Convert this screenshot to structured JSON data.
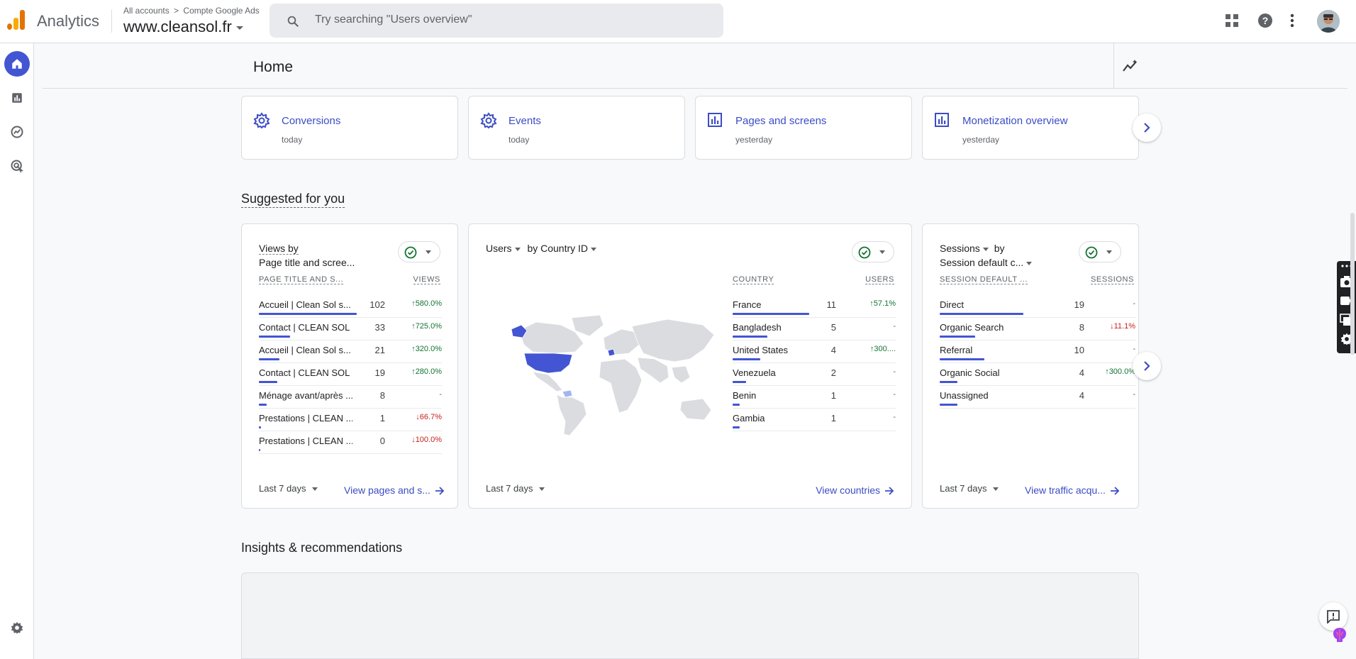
{
  "app": {
    "name": "Analytics",
    "breadcrumb_accounts": "All accounts",
    "breadcrumb_account": "Compte Google Ads",
    "property": "www.cleansol.fr"
  },
  "search": {
    "placeholder": "Try searching \"Users overview\""
  },
  "page": {
    "title": "Home"
  },
  "quick_cards": [
    {
      "title": "Conversions",
      "subtitle": "today",
      "icon": "gear-icon"
    },
    {
      "title": "Events",
      "subtitle": "today",
      "icon": "gear-icon"
    },
    {
      "title": "Pages and screens",
      "subtitle": "yesterday",
      "icon": "bar-chart-icon"
    },
    {
      "title": "Monetization overview",
      "subtitle": "yesterday",
      "icon": "bar-chart-icon"
    }
  ],
  "suggested": {
    "title": "Suggested for you",
    "pages_card": {
      "title_line1": "Views by",
      "title_line2": "Page title and scree...",
      "col_label": "PAGE TITLE AND S...",
      "col_value": "VIEWS",
      "rows": [
        {
          "label": "Accueil | Clean Sol s...",
          "value": "102",
          "change": "580.0%",
          "dir": "up",
          "bar": 1.0
        },
        {
          "label": "Contact | CLEAN SOL",
          "value": "33",
          "change": "725.0%",
          "dir": "up",
          "bar": 0.32
        },
        {
          "label": "Accueil | Clean Sol s...",
          "value": "21",
          "change": "320.0%",
          "dir": "up",
          "bar": 0.21
        },
        {
          "label": "Contact | CLEAN SOL",
          "value": "19",
          "change": "280.0%",
          "dir": "up",
          "bar": 0.19
        },
        {
          "label": "Ménage avant/après ...",
          "value": "8",
          "change": "-",
          "dir": "flat",
          "bar": 0.08
        },
        {
          "label": "Prestations | CLEAN ...",
          "value": "1",
          "change": "66.7%",
          "dir": "down",
          "bar": 0.01
        },
        {
          "label": "Prestations | CLEAN ...",
          "value": "0",
          "change": "100.0%",
          "dir": "down",
          "bar": 0.0
        }
      ],
      "range": "Last 7 days",
      "link": "View pages and s..."
    },
    "country_card": {
      "metric": "Users",
      "dimension": "by Country ID",
      "col_label": "COUNTRY",
      "col_value": "USERS",
      "rows": [
        {
          "label": "France",
          "value": "11",
          "change": "57.1%",
          "dir": "up",
          "bar": 1.0
        },
        {
          "label": "Bangladesh",
          "value": "5",
          "change": "-",
          "dir": "flat",
          "bar": 0.45
        },
        {
          "label": "United States",
          "value": "4",
          "change": "300....",
          "dir": "up",
          "bar": 0.36
        },
        {
          "label": "Venezuela",
          "value": "2",
          "change": "-",
          "dir": "flat",
          "bar": 0.18
        },
        {
          "label": "Benin",
          "value": "1",
          "change": "-",
          "dir": "flat",
          "bar": 0.09
        },
        {
          "label": "Gambia",
          "value": "1",
          "change": "-",
          "dir": "flat",
          "bar": 0.09
        }
      ],
      "range": "Last 7 days",
      "link": "View countries"
    },
    "sessions_card": {
      "title_metric": "Sessions",
      "title_by": "by",
      "title_line2": "Session default c...",
      "col_label": "SESSION DEFAULT ...",
      "col_value": "SESSIONS",
      "rows": [
        {
          "label": "Direct",
          "value": "19",
          "change": "-",
          "dir": "flat",
          "bar": 1.0
        },
        {
          "label": "Organic Search",
          "value": "8",
          "change": "11.1%",
          "dir": "down",
          "bar": 0.42
        },
        {
          "label": "Referral",
          "value": "10",
          "change": "-",
          "dir": "flat",
          "bar": 0.53
        },
        {
          "label": "Organic Social",
          "value": "4",
          "change": "300.0%",
          "dir": "up",
          "bar": 0.21
        },
        {
          "label": "Unassigned",
          "value": "4",
          "change": "-",
          "dir": "flat",
          "bar": 0.21
        }
      ],
      "range": "Last 7 days",
      "link": "View traffic acqu..."
    }
  },
  "insights": {
    "title": "Insights & recommendations"
  },
  "colors": {
    "accent": "#4355d3",
    "link": "#3c4cc4",
    "up": "#137333",
    "down": "#c5221f",
    "logo_orange": "#f9ab00",
    "logo_dark": "#e37400"
  }
}
